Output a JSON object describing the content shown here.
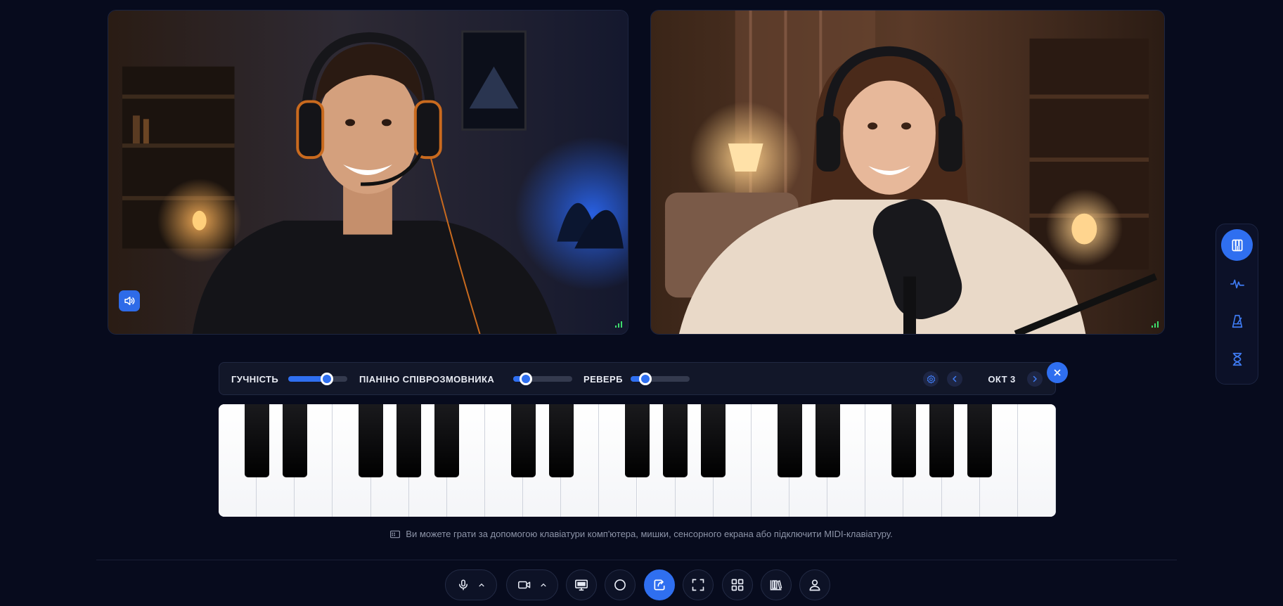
{
  "participants": [
    {
      "role": "local",
      "audio": "speaker-icon",
      "signal": "signal-icon"
    },
    {
      "role": "remote",
      "signal": "signal-icon"
    }
  ],
  "piano_controls": {
    "volume_label": "ГУЧНІСТЬ",
    "volume_level": 0.65,
    "partner_piano_label": "ПІАНІНО СПІВРОЗМОВНИКА",
    "partner_piano_level": 0.22,
    "reverb_label": "РЕВЕРБ",
    "reverb_level": 0.25,
    "octave_label": "ОКТ 3",
    "settings_icon": "gear-icon",
    "prev_icon": "chevron-left-icon",
    "next_icon": "chevron-right-icon",
    "close_icon": "close-icon"
  },
  "keyboard": {
    "white_keys": 22,
    "black_keys": 15
  },
  "hint": {
    "icon": "keyboard-icon",
    "text": "Ви можете грати за допомогою клавіатури комп'ютера, мишки, сенсорного екрана або підключити MIDI-клавіатуру."
  },
  "side_rail": [
    {
      "icon": "piano-icon",
      "active": true
    },
    {
      "icon": "waveform-icon",
      "active": false
    },
    {
      "icon": "metronome-icon",
      "active": false
    },
    {
      "icon": "hourglass-icon",
      "active": false
    }
  ],
  "toolbar": [
    {
      "icon": "microphone-icon",
      "menu": "chevron-up-icon"
    },
    {
      "icon": "camera-icon",
      "menu": "chevron-up-icon"
    },
    {
      "icon": "screen-share-icon"
    },
    {
      "icon": "record-icon"
    },
    {
      "icon": "share-icon",
      "active": true
    },
    {
      "icon": "fullscreen-icon"
    },
    {
      "icon": "grid-layout-icon"
    },
    {
      "icon": "library-icon"
    },
    {
      "icon": "user-icon"
    }
  ],
  "colors": {
    "background": "#070b1d",
    "accent": "#2f6ff0",
    "signal": "#3ddc6c"
  }
}
